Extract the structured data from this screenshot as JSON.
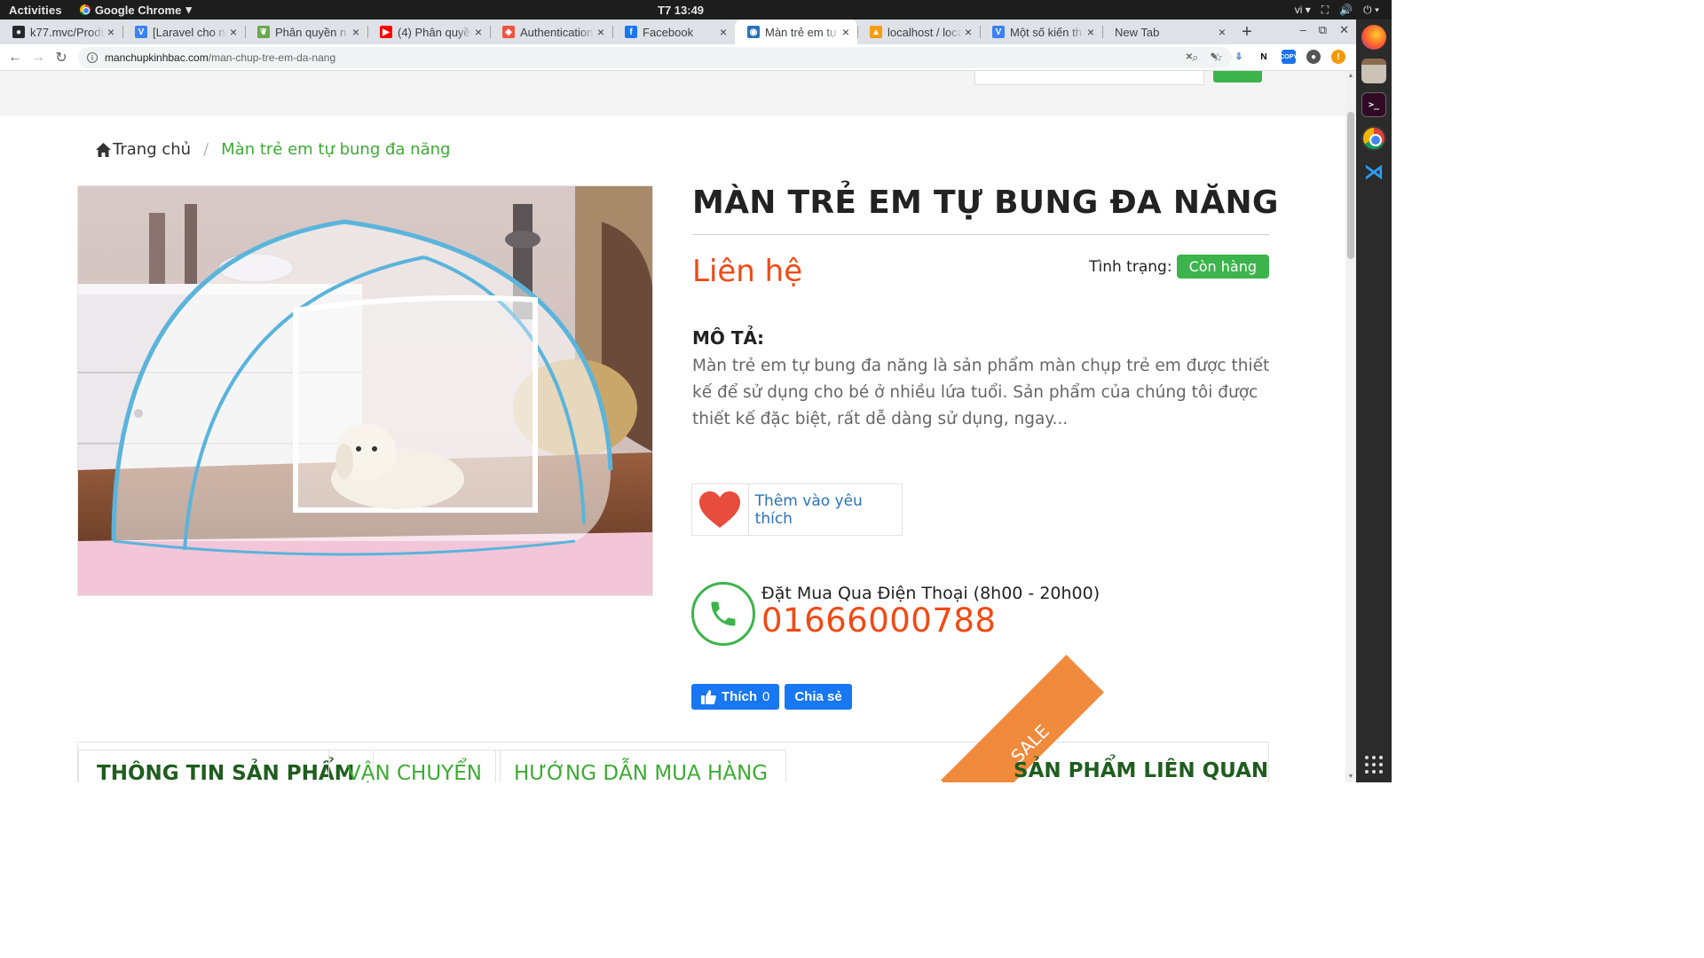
{
  "os": {
    "activities": "Activities",
    "app_name": "Google Chrome",
    "clock": "T7 13:49",
    "lang": "vi"
  },
  "tabs": [
    {
      "title": "k77.mvc/Produ",
      "icon": "github-icon",
      "color": "#24292e"
    },
    {
      "title": "[Laravel cho ng",
      "icon": "v-logo-icon",
      "color": "#3b82f6"
    },
    {
      "title": "Phân quyền n",
      "icon": "leaf-icon",
      "color": "#6aa84f"
    },
    {
      "title": "(4) Phân quyền",
      "icon": "youtube-icon",
      "color": "#ff0000"
    },
    {
      "title": "Authentication",
      "icon": "laravel-icon",
      "color": "#f05340"
    },
    {
      "title": "Facebook",
      "icon": "facebook-icon",
      "color": "#1877f2"
    },
    {
      "title": "Màn trẻ em tự b",
      "icon": "site-icon",
      "color": "#2a72b8",
      "active": true
    },
    {
      "title": "localhost / loca",
      "icon": "phpmyadmin-icon",
      "color": "#f89c0e"
    },
    {
      "title": "Một số kiến th",
      "icon": "v-logo-icon",
      "color": "#3b82f6"
    },
    {
      "title": "New Tab",
      "icon": "",
      "color": ""
    }
  ],
  "address": {
    "host": "manchupkinhbac.com",
    "path": "/man-chup-tre-em-da-nang"
  },
  "breadcrumb": {
    "home": "Trang chủ",
    "separator": "/",
    "current": "Màn trẻ em tự bung đa năng"
  },
  "product": {
    "title": "MÀN TRẺ EM TỰ BUNG ĐA NĂNG",
    "price": "Liên hệ",
    "status_label": "Tình trạng:",
    "status_value": "Còn hàng",
    "desc_label": "MÔ TẢ:",
    "description": "Màn trẻ em tự bung đa năng là sản phẩm màn chụp trẻ em được thiết kế để sử dụng cho bé ở nhiều lứa tuổi. Sản phẩm của chúng tôi được thiết kế đặc biệt, rất dễ dàng sử dụng, ngay...",
    "wishlist_label": "Thêm vào yêu thích",
    "phone_caption": "Đặt Mua Qua Điện Thoại (8h00 - 20h00)",
    "phone_number": "01666000788"
  },
  "social": {
    "like_label": "Thích",
    "like_count": "0",
    "share_label": "Chia sẻ"
  },
  "info_tabs": [
    "THÔNG TIN SẢN PHẨM",
    "VẬN CHUYỂN",
    "HƯỚNG DẪN MUA HÀNG"
  ],
  "related_title": "SẢN PHẨM LIÊN QUAN",
  "sale_badge": "SALE",
  "colors": {
    "accent_green": "#3cb44b",
    "price_orange": "#f04a14",
    "link_blue": "#2a72b8",
    "facebook_blue": "#1877f2"
  }
}
